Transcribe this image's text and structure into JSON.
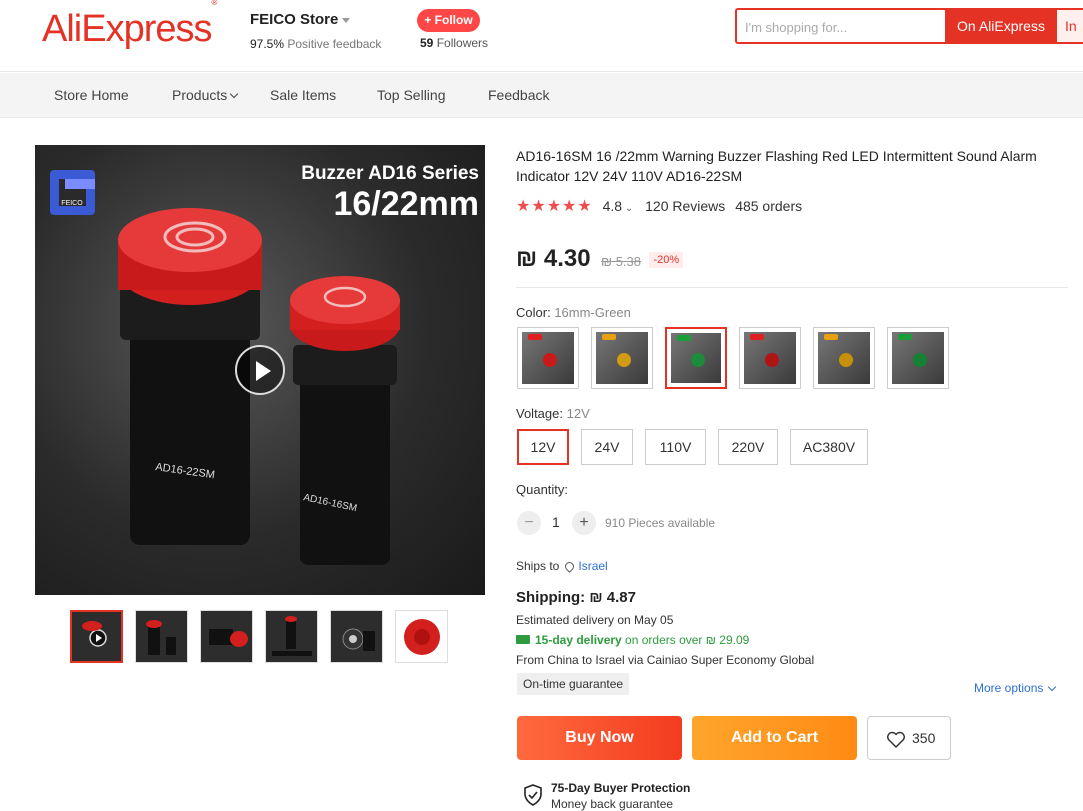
{
  "header": {
    "logo": "AliExpress",
    "store_name": "FEICO Store",
    "feedback_pct": "97.5%",
    "feedback_text": "Positive feedback",
    "follow_label": "+ Follow",
    "followers_count": "59",
    "followers_text": "Followers",
    "search_placeholder": "I'm shopping for...",
    "search_btn": "On AliExpress",
    "search_btn2": "In"
  },
  "nav": [
    "Store Home",
    "Products",
    "Sale Items",
    "Top Selling",
    "Feedback"
  ],
  "gallery": {
    "overlay_line1": "Buzzer AD16 Series",
    "overlay_line2": "16/22mm",
    "brand_text": "FEICO",
    "thumb_count": 6,
    "selected_thumb": 0
  },
  "product": {
    "title": "AD16-16SM 16 /22mm Warning Buzzer Flashing Red LED Intermittent Sound Alarm Indicator 12V 24V 110V AD16-22SM",
    "stars": "★★★★★",
    "rating": "4.8",
    "reviews": "120 Reviews",
    "orders": "485 orders",
    "price": "₪ 4.30",
    "orig_price": "₪ 5.38",
    "discount": "-20%"
  },
  "color": {
    "label": "Color:",
    "value": "16mm-Green",
    "options": [
      {
        "tag": "Red",
        "tag_color": "#e02020",
        "led": "#c81a1a"
      },
      {
        "tag": "Yellow",
        "tag_color": "#e8a010",
        "led": "#d49a10"
      },
      {
        "tag": "Green",
        "tag_color": "#1a9e3a",
        "led": "#1a8c3a"
      },
      {
        "tag": "Red",
        "tag_color": "#e02020",
        "led": "#b01515"
      },
      {
        "tag": "Yellow",
        "tag_color": "#e8a010",
        "led": "#c8900a"
      },
      {
        "tag": "Green",
        "tag_color": "#1a9e3a",
        "led": "#148232"
      }
    ],
    "selected": 2
  },
  "voltage": {
    "label": "Voltage:",
    "value": "12V",
    "options": [
      "12V",
      "24V",
      "110V",
      "220V",
      "AC380V"
    ],
    "selected": 0
  },
  "quantity": {
    "label": "Quantity:",
    "minus": "−",
    "value": "1",
    "plus": "+",
    "available": "910 Pieces available"
  },
  "shipping": {
    "ships_to_label": "Ships to",
    "ships_to": "Israel",
    "cost": "Shipping: ₪ 4.87",
    "estimate": "Estimated delivery on May 05",
    "fast_bold": "15-day delivery",
    "fast_rest": " on orders over ₪ 29.09",
    "route": "From China to Israel via Cainiao Super Economy Global",
    "guarantee": "On-time guarantee",
    "more": "More options"
  },
  "actions": {
    "buy": "Buy Now",
    "cart": "Add to Cart",
    "wish_count": "350"
  },
  "protection": {
    "title": "75-Day Buyer Protection",
    "subtitle": "Money back guarantee"
  },
  "colors": {
    "brand": "#e43225",
    "link": "#2e6fd6",
    "green": "#2e9c3e"
  }
}
